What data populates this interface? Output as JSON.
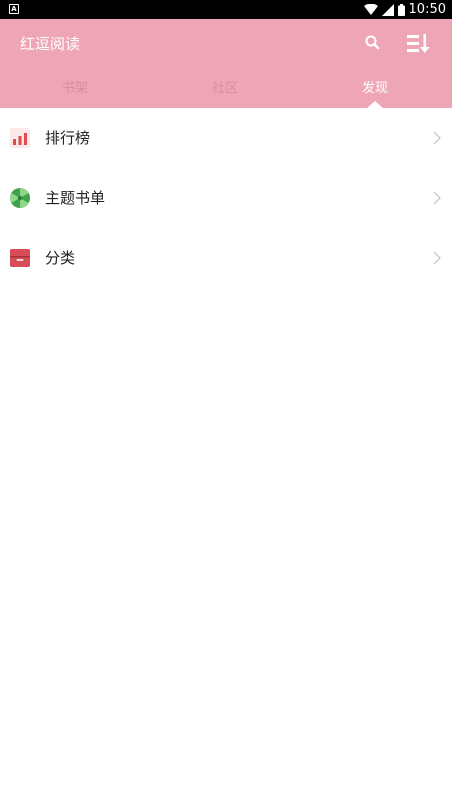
{
  "status_bar": {
    "time": "10:50",
    "notification_glyph": "A"
  },
  "app_bar": {
    "title": "红逗阅读",
    "color": "#eea6b6"
  },
  "tabs": [
    {
      "label": "书架",
      "active": false
    },
    {
      "label": "社区",
      "active": false
    },
    {
      "label": "发现",
      "active": true
    }
  ],
  "list": [
    {
      "label": "排行榜",
      "icon": "ranking-bar-chart-icon"
    },
    {
      "label": "主题书单",
      "icon": "theme-booklist-icon"
    },
    {
      "label": "分类",
      "icon": "category-box-icon"
    }
  ]
}
